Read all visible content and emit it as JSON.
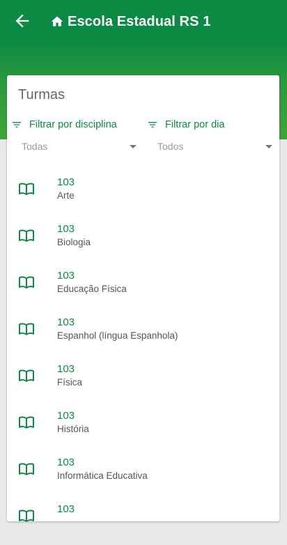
{
  "appbar": {
    "title": "Escola Estadual RS 1",
    "back_icon": "arrow-back-icon",
    "home_icon": "home-icon"
  },
  "colors": {
    "primary": "#0b8a43",
    "accent_green": "#3da63a"
  },
  "card": {
    "title": "Turmas",
    "filters": {
      "disciplina": {
        "label": "Filtrar por disciplina",
        "value": "Todas",
        "icon": "filter-icon"
      },
      "dia": {
        "label": "Filtrar por dia",
        "value": "Todos",
        "icon": "filter-icon"
      }
    },
    "items": [
      {
        "code": "103",
        "subject": "Arte"
      },
      {
        "code": "103",
        "subject": "Biologia"
      },
      {
        "code": "103",
        "subject": "Educação Física"
      },
      {
        "code": "103",
        "subject": "Espanhol (língua Espanhola)"
      },
      {
        "code": "103",
        "subject": "Física"
      },
      {
        "code": "103",
        "subject": "História"
      },
      {
        "code": "103",
        "subject": "Informática Educativa"
      },
      {
        "code": "103",
        "subject": ""
      }
    ]
  }
}
